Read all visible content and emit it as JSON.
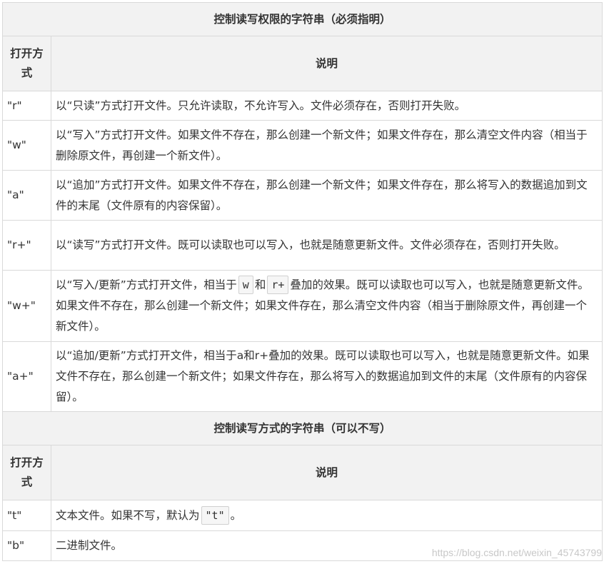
{
  "section1": {
    "title": "控制读写权限的字符串（必须指明）",
    "col_mode": "打开方式",
    "col_desc": "说明",
    "rows": [
      {
        "mode": "\"r\"",
        "desc": "以“只读”方式打开文件。只允许读取，不允许写入。文件必须存在，否则打开失败。"
      },
      {
        "mode": "\"w\"",
        "desc": "以“写入”方式打开文件。如果文件不存在，那么创建一个新文件；如果文件存在，那么清空文件内容（相当于删除原文件，再创建一个新文件）。"
      },
      {
        "mode": "\"a\"",
        "desc": "以“追加”方式打开文件。如果文件不存在，那么创建一个新文件；如果文件存在，那么将写入的数据追加到文件的末尾（文件原有的内容保留）。"
      },
      {
        "mode": "\"r+\"",
        "desc": "以“读写”方式打开文件。既可以读取也可以写入，也就是随意更新文件。文件必须存在，否则打开失败。"
      },
      {
        "mode": "\"w+\"",
        "desc_a": "以“写入/更新”方式打开文件，相当于",
        "code1": "w",
        "desc_b": "和",
        "code2": "r+",
        "desc_c": "叠加的效果。既可以读取也可以写入，也就是随意更新文件。如果文件不存在，那么创建一个新文件；如果文件存在，那么清空文件内容（相当于删除原文件，再创建一个新文件）。"
      },
      {
        "mode": "\"a+\"",
        "desc": "以“追加/更新”方式打开文件，相当于a和r+叠加的效果。既可以读取也可以写入，也就是随意更新文件。如果文件不存在，那么创建一个新文件；如果文件存在，那么将写入的数据追加到文件的末尾（文件原有的内容保留）。"
      }
    ]
  },
  "section2": {
    "title": "控制读写方式的字符串（可以不写）",
    "col_mode": "打开方式",
    "col_desc": "说明",
    "rows": [
      {
        "mode": "\"t\"",
        "desc_a": "文本文件。如果不写，默认为",
        "code1": "\"t\"",
        "desc_b": "。"
      },
      {
        "mode": "\"b\"",
        "desc": "二进制文件。"
      }
    ]
  },
  "watermark": "https://blog.csdn.net/weixin_45743799"
}
